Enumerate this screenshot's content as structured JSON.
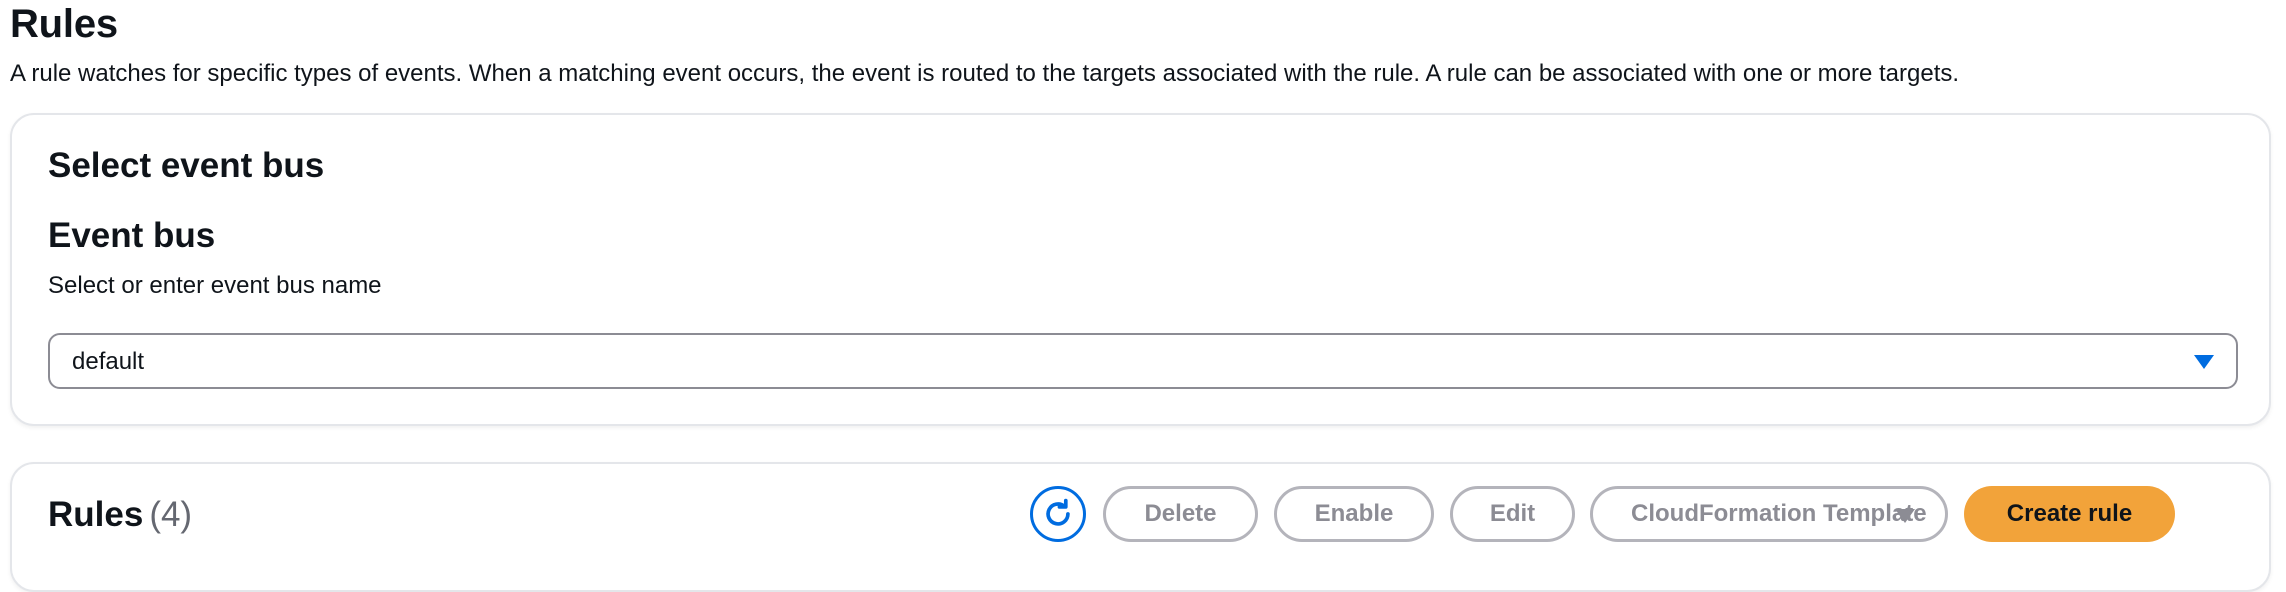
{
  "page": {
    "title": "Rules",
    "description": "A rule watches for specific types of events. When a matching event occurs, the event is routed to the targets associated with the rule. A rule can be associated with one or more targets."
  },
  "event_bus_card": {
    "title": "Select event bus",
    "field_label": "Event bus",
    "field_description": "Select or enter event bus name",
    "selected_value": "default"
  },
  "rules_card": {
    "title": "Rules",
    "count": "(4)",
    "refresh_icon": "refresh-icon",
    "buttons": {
      "delete": "Delete",
      "enable": "Enable",
      "edit": "Edit",
      "cloudformation": "CloudFormation Template",
      "create": "Create rule"
    }
  },
  "colors": {
    "primary": "#f2a33a",
    "link_blue": "#006ce0",
    "disabled_text": "#8c8c94",
    "disabled_border": "#b4b4bb"
  }
}
